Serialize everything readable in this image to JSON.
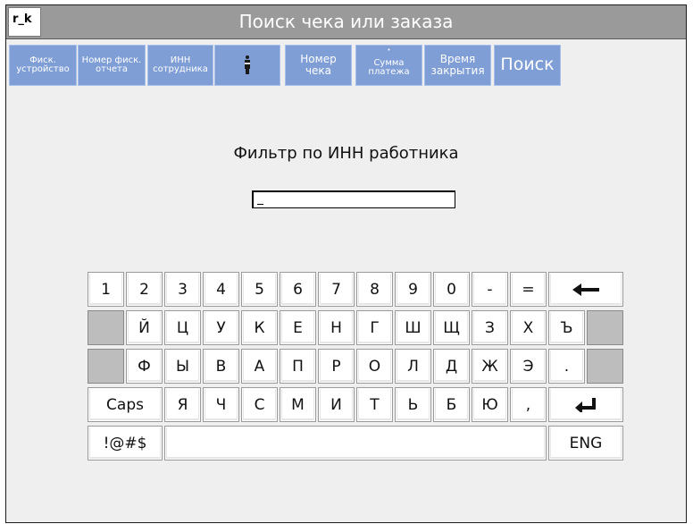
{
  "app": {
    "user": "r_k",
    "title": "Поиск чека или заказа"
  },
  "toolbar": {
    "fiscal_device": [
      "Фиск.",
      "устройство"
    ],
    "fiscal_report": [
      "Номер фиск.",
      "отчета"
    ],
    "employee_inn": [
      "ИНН",
      "сотрудника"
    ],
    "cashier_icon": "person-icon",
    "receipt_number": [
      "Номер",
      "чека"
    ],
    "payment_sum": [
      "Сумма",
      "платежа"
    ],
    "close_time": [
      "Время",
      "закрытия"
    ],
    "search": "Поиск"
  },
  "filter": {
    "title": "Фильтр по ИНН работника",
    "value": ""
  },
  "keyboard": {
    "row1": [
      "1",
      "2",
      "3",
      "4",
      "5",
      "6",
      "7",
      "8",
      "9",
      "0",
      "-",
      "="
    ],
    "backspace_icon": "arrow-left-icon",
    "row2": [
      "Й",
      "Ц",
      "У",
      "К",
      "Е",
      "Н",
      "Г",
      "Ш",
      "Щ",
      "З",
      "Х",
      "Ъ"
    ],
    "row3": [
      "Ф",
      "Ы",
      "В",
      "А",
      "П",
      "Р",
      "О",
      "Л",
      "Д",
      "Ж",
      "Э",
      "."
    ],
    "caps": "Caps",
    "row4": [
      "Я",
      "Ч",
      "С",
      "М",
      "И",
      "Т",
      "Ь",
      "Б",
      "Ю",
      ","
    ],
    "enter_icon": "enter-icon",
    "symbols": "!@#$",
    "lang": "ENG"
  },
  "colors": {
    "title_bar": "#9a9a9a",
    "toolbar_button": "#7f9ed6",
    "background": "#efefef"
  }
}
